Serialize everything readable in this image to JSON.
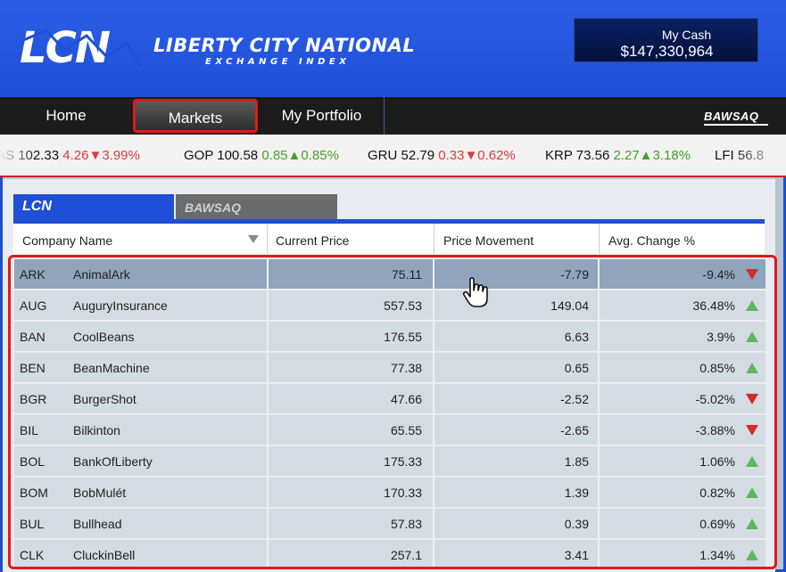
{
  "header": {
    "logo_mark": "LCN",
    "logo_title": "LIBERTY CITY NATIONAL",
    "logo_subtitle": "EXCHANGE INDEX",
    "cash_label": "My Cash",
    "cash_value": "$147,330,964"
  },
  "nav": {
    "tabs": [
      {
        "label": "Home"
      },
      {
        "label": "Markets"
      },
      {
        "label": "My Portfolio"
      }
    ],
    "active_tab": "Markets",
    "brand": "BAWSAQ"
  },
  "ticker": [
    {
      "symbol": "AS",
      "price": "102.33",
      "change": "4.26",
      "pct": "3.99%",
      "direction": "down"
    },
    {
      "symbol": "GOP",
      "price": "100.58",
      "change": "0.85",
      "pct": "0.85%",
      "direction": "up"
    },
    {
      "symbol": "GRU",
      "price": "52.79",
      "change": "0.33",
      "pct": "0.62%",
      "direction": "down"
    },
    {
      "symbol": "KRP",
      "price": "73.56",
      "change": "2.27",
      "pct": "3.18%",
      "direction": "up"
    },
    {
      "symbol": "LFI",
      "price": "56.8",
      "change": "",
      "pct": "",
      "direction": ""
    }
  ],
  "exchange_tabs": [
    {
      "label": "LCN",
      "active": true
    },
    {
      "label": "BAWSAQ",
      "active": false
    }
  ],
  "table": {
    "columns": [
      "Company Name",
      "Current Price",
      "Price Movement",
      "Avg. Change %"
    ],
    "rows": [
      {
        "symbol": "ARK",
        "name": "AnimalArk",
        "price": "75.11",
        "movement": "-7.79",
        "change": "-9.4%",
        "direction": "down",
        "selected": true
      },
      {
        "symbol": "AUG",
        "name": "AuguryInsurance",
        "price": "557.53",
        "movement": "149.04",
        "change": "36.48%",
        "direction": "up"
      },
      {
        "symbol": "BAN",
        "name": "CoolBeans",
        "price": "176.55",
        "movement": "6.63",
        "change": "3.9%",
        "direction": "up"
      },
      {
        "symbol": "BEN",
        "name": "BeanMachine",
        "price": "77.38",
        "movement": "0.65",
        "change": "0.85%",
        "direction": "up"
      },
      {
        "symbol": "BGR",
        "name": "BurgerShot",
        "price": "47.66",
        "movement": "-2.52",
        "change": "-5.02%",
        "direction": "down"
      },
      {
        "symbol": "BIL",
        "name": "Bilkinton",
        "price": "65.55",
        "movement": "-2.65",
        "change": "-3.88%",
        "direction": "down"
      },
      {
        "symbol": "BOL",
        "name": "BankOfLiberty",
        "price": "175.33",
        "movement": "1.85",
        "change": "1.06%",
        "direction": "up"
      },
      {
        "symbol": "BOM",
        "name": "BobMulét",
        "price": "170.33",
        "movement": "1.39",
        "change": "0.82%",
        "direction": "up"
      },
      {
        "symbol": "BUL",
        "name": "Bullhead",
        "price": "57.83",
        "movement": "0.39",
        "change": "0.69%",
        "direction": "up"
      },
      {
        "symbol": "CLK",
        "name": "CluckinBell",
        "price": "257.1",
        "movement": "3.41",
        "change": "1.34%",
        "direction": "up"
      }
    ]
  },
  "colors": {
    "brand_blue": "#1f4fd6",
    "highlight_red": "#e01a1a",
    "up_green": "#5cb85c",
    "down_red": "#d52a2a"
  },
  "icons": {
    "sort": "sort-down-icon",
    "cursor": "hand-pointer-icon",
    "up": "triangle-up-icon",
    "down": "triangle-down-icon"
  }
}
